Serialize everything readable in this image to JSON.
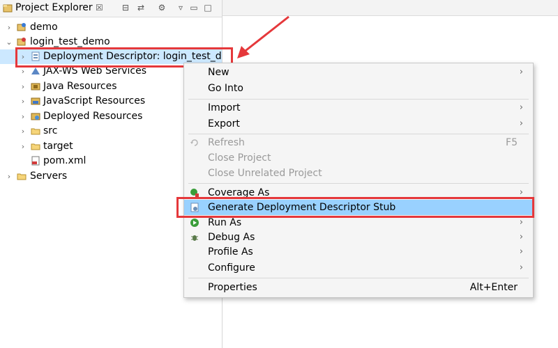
{
  "explorer": {
    "title": "Project Explorer",
    "close_glyph": "☒"
  },
  "tree": [
    {
      "label": "demo",
      "icon": "project-icon",
      "chevron": "›"
    },
    {
      "label": "login_test_demo",
      "icon": "project-icon",
      "chevron": "⌄"
    },
    {
      "label": "Deployment Descriptor: login_test_d",
      "icon": "descriptor-icon",
      "chevron": "›"
    },
    {
      "label": "JAX-WS Web Services",
      "icon": "webservice-icon",
      "chevron": "›"
    },
    {
      "label": "Java Resources",
      "icon": "java-resources-icon",
      "chevron": "›"
    },
    {
      "label": "JavaScript Resources",
      "icon": "javascript-icon",
      "chevron": "›"
    },
    {
      "label": "Deployed Resources",
      "icon": "deployed-icon",
      "chevron": "›"
    },
    {
      "label": "src",
      "icon": "folder-icon",
      "chevron": "›"
    },
    {
      "label": "target",
      "icon": "folder-icon",
      "chevron": "›"
    },
    {
      "label": "pom.xml",
      "icon": "xml-file-icon",
      "chevron": ""
    },
    {
      "label": "Servers",
      "icon": "folder-icon",
      "chevron": "›"
    }
  ],
  "menu": {
    "new": "New",
    "go_into": "Go Into",
    "import": "Import",
    "export": "Export",
    "refresh": "Refresh",
    "refresh_shortcut": "F5",
    "close_project": "Close Project",
    "close_unrelated": "Close Unrelated Project",
    "coverage_as": "Coverage As",
    "generate_stub": "Generate Deployment Descriptor Stub",
    "run_as": "Run As",
    "debug_as": "Debug As",
    "profile_as": "Profile As",
    "configure": "Configure",
    "properties": "Properties",
    "properties_shortcut": "Alt+Enter",
    "submenu_arrow": "›"
  },
  "colors": {
    "highlight": "#99d1ff",
    "annotation": "#e5383b"
  }
}
